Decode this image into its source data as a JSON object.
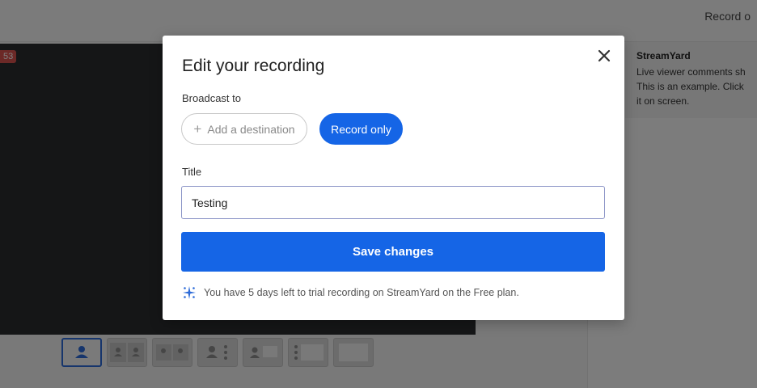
{
  "background": {
    "topbar_link": "Record o",
    "timer_badge": "53",
    "comment": {
      "author": "StreamYard",
      "lines": [
        "Live viewer comments sh",
        "This is an example. Click",
        "it on screen."
      ]
    },
    "layout_icons": [
      "single-person-layout-icon",
      "two-person-layout-icon",
      "two-person-split-layout-icon",
      "person-with-list-layout-icon",
      "person-with-screen-layout-icon",
      "list-with-screen-layout-icon",
      "screen-only-layout-icon"
    ]
  },
  "modal": {
    "title": "Edit your recording",
    "broadcast_label": "Broadcast to",
    "add_destination_label": "Add a destination",
    "record_only_label": "Record only",
    "title_label": "Title",
    "title_value": "Testing",
    "save_label": "Save changes",
    "trial_text": "You have 5 days left to trial recording on StreamYard on the Free plan.",
    "close_icon": "close-icon",
    "sparkle_icon": "sparkle-icon"
  },
  "colors": {
    "primary": "#1565e6",
    "overlay": "rgba(0,0,0,0.5)",
    "timer": "#d9534f"
  }
}
